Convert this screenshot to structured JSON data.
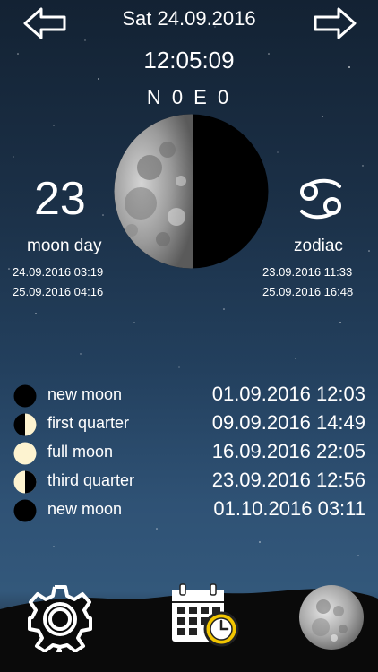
{
  "header": {
    "date": "Sat 24.09.2016",
    "time": "12:05:09",
    "coordinates": "N 0 E 0"
  },
  "moon_day": {
    "value": "23",
    "label": "moon day",
    "start": "24.09.2016 03:19",
    "end": "25.09.2016 04:16"
  },
  "zodiac": {
    "label": "zodiac",
    "icon": "cancer-zodiac-icon",
    "start": "23.09.2016 11:33",
    "end": "25.09.2016 16:48"
  },
  "phases": [
    {
      "name": "new moon",
      "datetime": "01.09.2016 12:03",
      "icon": "new-moon-icon"
    },
    {
      "name": "first quarter",
      "datetime": "09.09.2016 14:49",
      "icon": "first-quarter-icon"
    },
    {
      "name": "full moon",
      "datetime": "16.09.2016 22:05",
      "icon": "full-moon-icon"
    },
    {
      "name": "third quarter",
      "datetime": "23.09.2016 12:56",
      "icon": "third-quarter-icon"
    },
    {
      "name": "new moon",
      "datetime": "01.10.2016 03:11",
      "icon": "new-moon-icon"
    }
  ],
  "colors": {
    "moon_light": "#fdf3d0",
    "moon_dark": "#000000",
    "clock_badge": "#f2c500"
  }
}
